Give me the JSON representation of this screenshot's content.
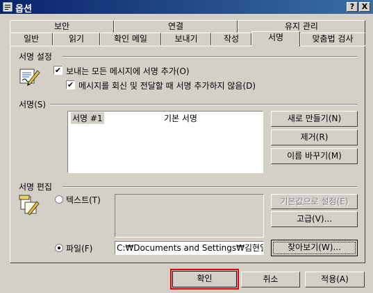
{
  "window": {
    "title": "옵션",
    "help_btn": "?",
    "close_btn": "X"
  },
  "tabs_row1": [
    {
      "label": "보안"
    },
    {
      "label": "연결"
    },
    {
      "label": "유지 관리"
    }
  ],
  "tabs_row2": [
    {
      "label": "일반"
    },
    {
      "label": "읽기"
    },
    {
      "label": "확인 메일"
    },
    {
      "label": "보내기"
    },
    {
      "label": "작성"
    },
    {
      "label": "서명"
    },
    {
      "label": "맞춤법 검사"
    }
  ],
  "sig_settings": {
    "heading": "서명 설정",
    "check1": {
      "label": "보내는 모든 메시지에 서명 추가(O)",
      "checked": true
    },
    "check2": {
      "label": "메시지를 회신 및 전달할 때 서명 추가하지 않음(D)",
      "checked": true
    }
  },
  "signature": {
    "heading": "서명(S)",
    "list": [
      {
        "name": "서명 #1",
        "type": "기본 서명"
      }
    ],
    "new_btn": "새로 만들기(N)",
    "remove_btn": "제거(R)",
    "rename_btn": "이름 바꾸기(M)"
  },
  "sig_edit": {
    "heading": "서명 편집",
    "text_radio": "텍스트(T)",
    "file_radio": "파일(F)",
    "file_path": "C:₩Documents and Settings₩김현일",
    "default_btn": "기본값으로 설정(E)",
    "advanced_btn": "고급(V)...",
    "browse_btn": "찾아보기(W)..."
  },
  "footer": {
    "ok": "확인",
    "cancel": "취소",
    "apply": "적용(A)"
  },
  "colors": {
    "title_start": "#0a246a",
    "title_end": "#3a6ea5",
    "highlight": "#e00000"
  }
}
